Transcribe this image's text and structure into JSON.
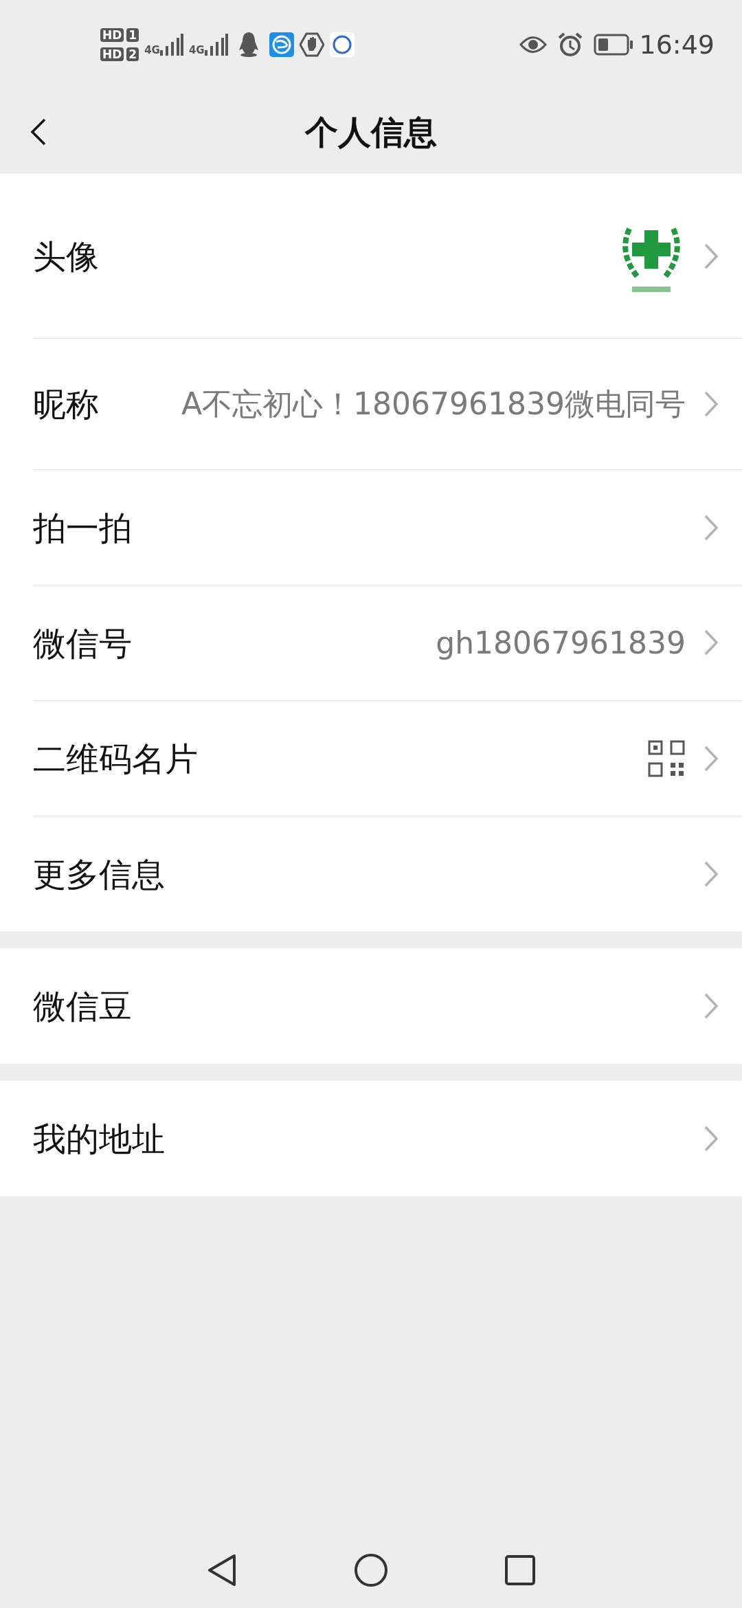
{
  "status_bar": {
    "sims": [
      {
        "tech": "HD",
        "slot": "1"
      },
      {
        "tech": "HD",
        "slot": "2"
      }
    ],
    "networks": [
      "4G",
      "4G"
    ],
    "time": "16:49"
  },
  "header": {
    "title": "个人信息"
  },
  "groups": [
    {
      "rows": [
        {
          "label": "头像",
          "kind": "avatar"
        },
        {
          "label": "昵称",
          "kind": "text",
          "value": "A不忘初心！18067961839微电同号"
        },
        {
          "label": "拍一拍",
          "kind": "plain"
        },
        {
          "label": "微信号",
          "kind": "text",
          "value": "gh18067961839"
        },
        {
          "label": "二维码名片",
          "kind": "qr"
        },
        {
          "label": "更多信息",
          "kind": "plain"
        }
      ]
    },
    {
      "rows": [
        {
          "label": "微信豆",
          "kind": "plain"
        }
      ]
    },
    {
      "rows": [
        {
          "label": "我的地址",
          "kind": "plain"
        }
      ]
    }
  ]
}
